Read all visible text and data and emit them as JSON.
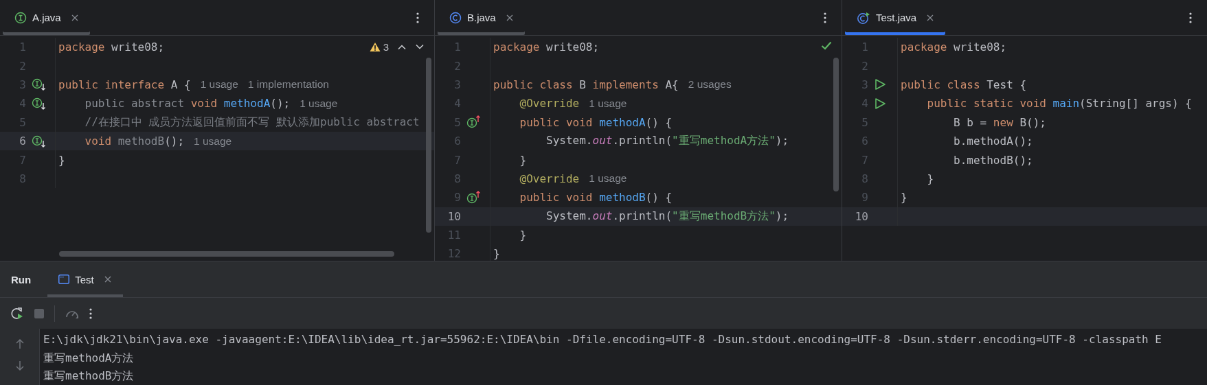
{
  "editors": [
    {
      "tab": {
        "label": "A.java",
        "kind": "interface",
        "focused": false
      },
      "inspection": {
        "kind": "warnings",
        "count": "3"
      },
      "scrollbars": [
        {
          "kind": "vertical"
        },
        {
          "kind": "horizontal"
        }
      ],
      "lines": [
        {
          "number": "1",
          "current": false,
          "tokens": [
            {
              "kind": "keyword",
              "text": "package "
            },
            {
              "kind": "plain",
              "text": "write08;"
            }
          ]
        },
        {
          "number": "2",
          "current": false
        },
        {
          "number": "3",
          "current": false,
          "gutter": {
            "kind": "implemented"
          },
          "tokens": [
            {
              "kind": "keyword",
              "text": "public interface "
            },
            {
              "kind": "plain",
              "text": "A {"
            }
          ],
          "hints": [
            "1 usage",
            "1 implementation"
          ]
        },
        {
          "number": "4",
          "current": false,
          "gutter": {
            "kind": "implemented"
          },
          "tokens": [
            {
              "kind": "muted",
              "text": "    public abstract "
            },
            {
              "kind": "keyword",
              "text": "void "
            },
            {
              "kind": "method",
              "text": "methodA"
            },
            {
              "kind": "plain",
              "text": "();"
            }
          ],
          "hints": [
            "1 usage"
          ]
        },
        {
          "number": "5",
          "current": false,
          "tokens": [
            {
              "kind": "comment",
              "text": "    //在接口中 成员方法返回值前面不写 默认添加public abstract"
            }
          ]
        },
        {
          "number": "6",
          "current": true,
          "gutter": {
            "kind": "implemented"
          },
          "tokens": [
            {
              "kind": "keyword",
              "text": "    void "
            },
            {
              "kind": "muted",
              "text": "methodB"
            },
            {
              "kind": "plain",
              "text": "();"
            }
          ],
          "hints": [
            "1 usage"
          ]
        },
        {
          "number": "7",
          "current": false,
          "tokens": [
            {
              "kind": "plain",
              "text": "}"
            }
          ]
        },
        {
          "number": "8",
          "current": false
        }
      ]
    },
    {
      "tab": {
        "label": "B.java",
        "kind": "class",
        "focused": false
      },
      "inspection": {
        "kind": "ok"
      },
      "scrollbars": [
        {
          "kind": "vertical"
        }
      ],
      "lines": [
        {
          "number": "1",
          "current": false,
          "tokens": [
            {
              "kind": "keyword",
              "text": "package "
            },
            {
              "kind": "plain",
              "text": "write08;"
            }
          ]
        },
        {
          "number": "2",
          "current": false
        },
        {
          "number": "3",
          "current": false,
          "tokens": [
            {
              "kind": "keyword",
              "text": "public class "
            },
            {
              "kind": "plain",
              "text": "B "
            },
            {
              "kind": "keyword",
              "text": "implements "
            },
            {
              "kind": "plain",
              "text": "A{"
            }
          ],
          "hints": [
            "2 usages"
          ]
        },
        {
          "number": "4",
          "current": false,
          "tokens": [
            {
              "kind": "annotation",
              "text": "    @Override"
            }
          ],
          "hints": [
            "1 usage"
          ]
        },
        {
          "number": "5",
          "current": false,
          "gutter": {
            "kind": "overrides"
          },
          "tokens": [
            {
              "kind": "keyword",
              "text": "    public void "
            },
            {
              "kind": "method",
              "text": "methodA"
            },
            {
              "kind": "plain",
              "text": "() {"
            }
          ]
        },
        {
          "number": "6",
          "current": false,
          "tokens": [
            {
              "kind": "plain",
              "text": "        System."
            },
            {
              "kind": "field",
              "text": "out"
            },
            {
              "kind": "plain",
              "text": ".println("
            },
            {
              "kind": "string",
              "text": "\"重写methodA方法\""
            },
            {
              "kind": "plain",
              "text": ");"
            }
          ]
        },
        {
          "number": "7",
          "current": false,
          "tokens": [
            {
              "kind": "plain",
              "text": "    }"
            }
          ]
        },
        {
          "number": "8",
          "current": false,
          "tokens": [
            {
              "kind": "annotation",
              "text": "    @Override"
            }
          ],
          "hints": [
            "1 usage"
          ]
        },
        {
          "number": "9",
          "current": false,
          "gutter": {
            "kind": "overrides"
          },
          "tokens": [
            {
              "kind": "keyword",
              "text": "    public void "
            },
            {
              "kind": "method",
              "text": "methodB"
            },
            {
              "kind": "plain",
              "text": "() {"
            }
          ]
        },
        {
          "number": "10",
          "current": true,
          "tokens": [
            {
              "kind": "plain",
              "text": "        System."
            },
            {
              "kind": "field",
              "text": "out"
            },
            {
              "kind": "plain",
              "text": ".println("
            },
            {
              "kind": "string",
              "text": "\"重写methodB方法\""
            },
            {
              "kind": "plain",
              "text": ");"
            }
          ]
        },
        {
          "number": "11",
          "current": false,
          "tokens": [
            {
              "kind": "plain",
              "text": "    }"
            }
          ]
        },
        {
          "number": "12",
          "current": false,
          "tokens": [
            {
              "kind": "plain",
              "text": "}"
            }
          ]
        }
      ]
    },
    {
      "tab": {
        "label": "Test.java",
        "kind": "runnable-class",
        "focused": true
      },
      "lines": [
        {
          "number": "1",
          "current": false,
          "tokens": [
            {
              "kind": "keyword",
              "text": "package "
            },
            {
              "kind": "plain",
              "text": "write08;"
            }
          ]
        },
        {
          "number": "2",
          "current": false
        },
        {
          "number": "3",
          "current": false,
          "gutter": {
            "kind": "run"
          },
          "tokens": [
            {
              "kind": "keyword",
              "text": "public class "
            },
            {
              "kind": "plain",
              "text": "Test {"
            }
          ]
        },
        {
          "number": "4",
          "current": false,
          "gutter": {
            "kind": "run"
          },
          "tokens": [
            {
              "kind": "keyword",
              "text": "    public static void "
            },
            {
              "kind": "method",
              "text": "main"
            },
            {
              "kind": "plain",
              "text": "(String[] args) {"
            }
          ]
        },
        {
          "number": "5",
          "current": false,
          "tokens": [
            {
              "kind": "plain",
              "text": "        B b = "
            },
            {
              "kind": "keyword",
              "text": "new "
            },
            {
              "kind": "plain",
              "text": "B();"
            }
          ]
        },
        {
          "number": "6",
          "current": false,
          "tokens": [
            {
              "kind": "plain",
              "text": "        b.methodA();"
            }
          ]
        },
        {
          "number": "7",
          "current": false,
          "tokens": [
            {
              "kind": "plain",
              "text": "        b.methodB();"
            }
          ]
        },
        {
          "number": "8",
          "current": false,
          "tokens": [
            {
              "kind": "plain",
              "text": "    }"
            }
          ]
        },
        {
          "number": "9",
          "current": false,
          "tokens": [
            {
              "kind": "plain",
              "text": "}"
            }
          ]
        },
        {
          "number": "10",
          "current": true
        }
      ]
    }
  ],
  "run_panel": {
    "title": "Run",
    "tabs": [
      {
        "label": "Test",
        "selected": true
      }
    ],
    "console": [
      "E:\\jdk\\jdk21\\bin\\java.exe -javaagent:E:\\IDEA\\lib\\idea_rt.jar=55962:E:\\IDEA\\bin -Dfile.encoding=UTF-8 -Dsun.stdout.encoding=UTF-8 -Dsun.stderr.encoding=UTF-8 -classpath E",
      "重写methodA方法",
      "重写methodB方法"
    ]
  }
}
